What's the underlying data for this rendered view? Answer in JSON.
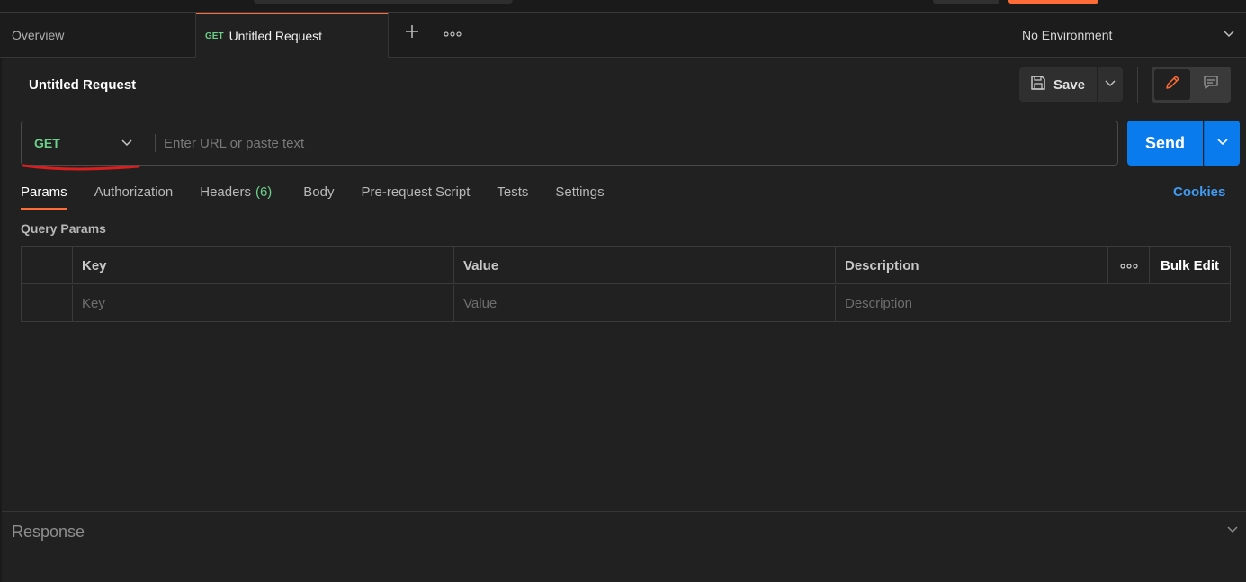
{
  "tabs": {
    "overview_label": "Overview",
    "active_tab": {
      "method": "GET",
      "label": "Untitled Request"
    },
    "new_tab_icon": "plus-icon",
    "more_icon": "ellipsis-icon"
  },
  "environment": {
    "selected": "No Environment"
  },
  "request": {
    "title": "Untitled Request",
    "save_label": "Save",
    "method": "GET",
    "url_value": "",
    "url_placeholder": "Enter URL or paste text",
    "send_label": "Send"
  },
  "request_tabs": [
    {
      "label": "Params",
      "active": true
    },
    {
      "label": "Authorization"
    },
    {
      "label": "Headers",
      "count": "(6)"
    },
    {
      "label": "Body"
    },
    {
      "label": "Pre-request Script"
    },
    {
      "label": "Tests"
    },
    {
      "label": "Settings"
    }
  ],
  "cookies_label": "Cookies",
  "query_params": {
    "title": "Query Params",
    "headers": {
      "key": "Key",
      "value": "Value",
      "description": "Description",
      "bulk_edit": "Bulk Edit"
    },
    "placeholders": {
      "key": "Key",
      "value": "Value",
      "description": "Description"
    }
  },
  "response": {
    "label": "Response"
  },
  "colors": {
    "accent": "#ff6c37",
    "method_get": "#6bd08a",
    "send": "#097bed",
    "link": "#3f9cf2",
    "annotation": "#d81e1e"
  }
}
